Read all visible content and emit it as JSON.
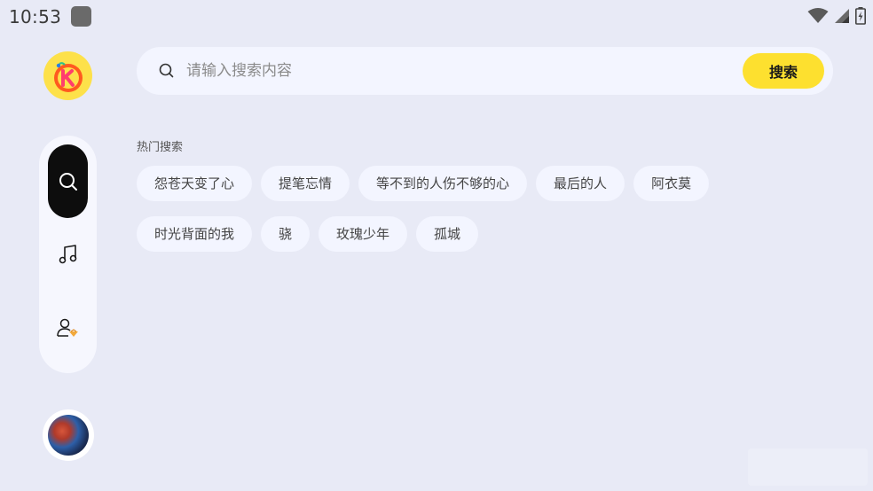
{
  "status_bar": {
    "time": "10:53",
    "icons": [
      "app-notification-icon",
      "wifi-icon",
      "signal-icon",
      "battery-charging-icon"
    ]
  },
  "sidebar": {
    "logo_icon": "k-music-logo-icon",
    "nav_items": [
      {
        "id": "search",
        "icon": "search-icon",
        "active": true
      },
      {
        "id": "music",
        "icon": "music-note-icon",
        "active": false
      },
      {
        "id": "profile",
        "icon": "user-vip-icon",
        "active": false
      }
    ],
    "avatar_icon": "now-playing-album-cover"
  },
  "search": {
    "placeholder": "请输入搜索内容",
    "value": "",
    "button_label": "搜索"
  },
  "hot_search": {
    "title": "热门搜索",
    "rows": [
      [
        "怨苍天变了心",
        "提笔忘情",
        "等不到的人伤不够的心",
        "最后的人",
        "阿衣莫"
      ],
      [
        "时光背面的我",
        "骁",
        "玫瑰少年",
        "孤城"
      ]
    ]
  },
  "colors": {
    "background": "#e8eaf6",
    "accent_yellow": "#fde02f",
    "active_nav": "#0d0d0d",
    "chip_bg": "#f3f5ff"
  }
}
